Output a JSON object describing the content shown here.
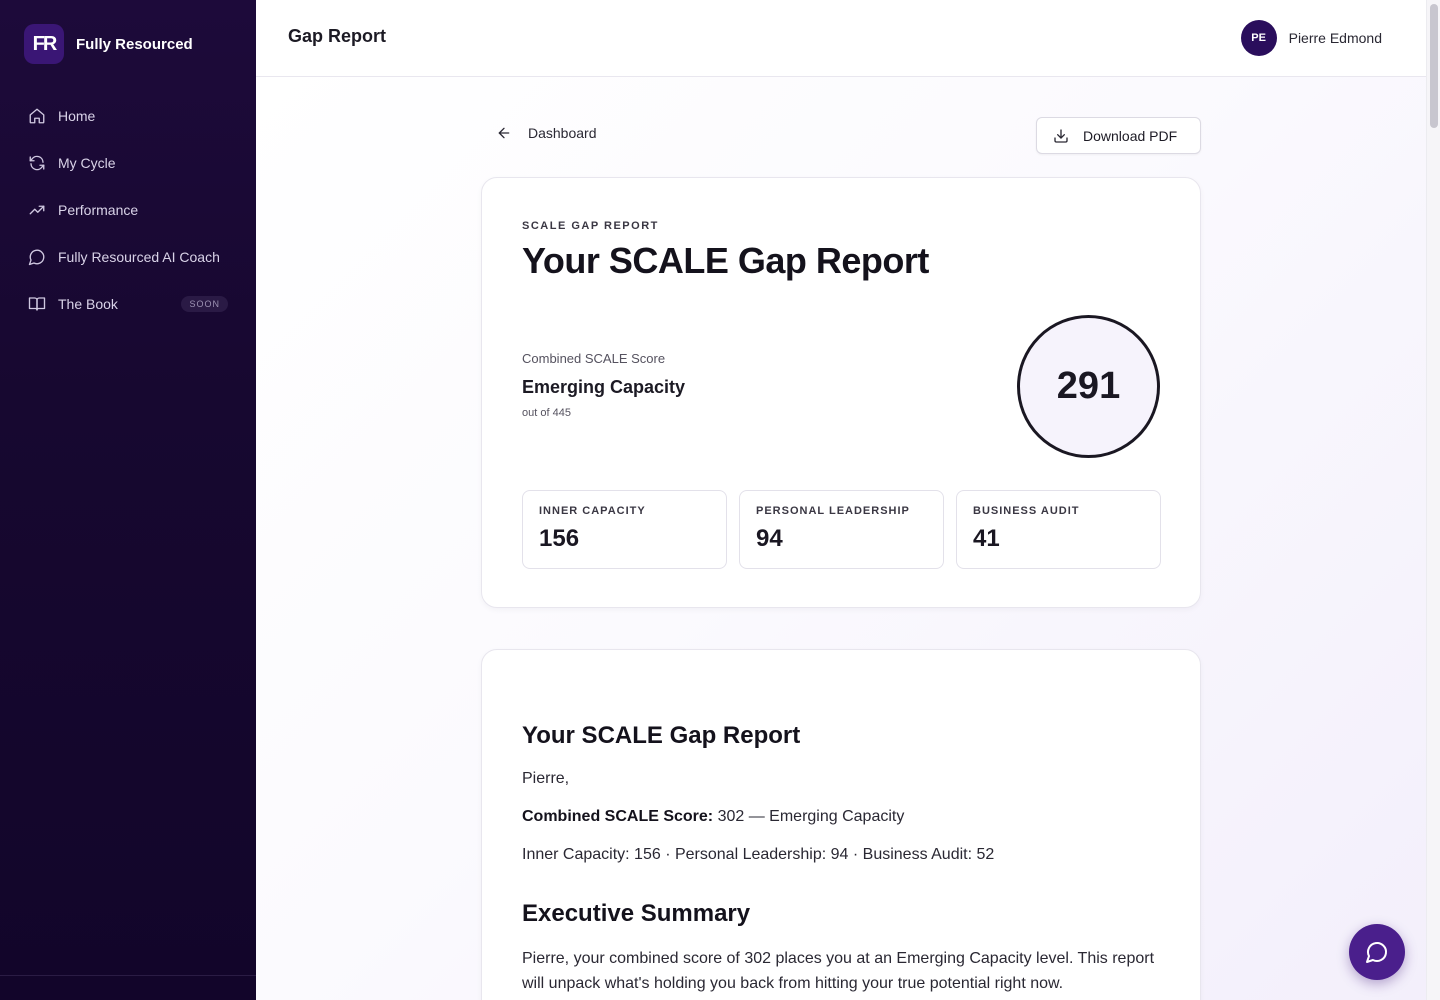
{
  "brand": {
    "logo": "FR",
    "name": "Fully Resourced"
  },
  "sidebar": {
    "items": [
      {
        "label": "Home",
        "icon": "home-icon"
      },
      {
        "label": "My Cycle",
        "icon": "refresh-icon"
      },
      {
        "label": "Performance",
        "icon": "trend-up-icon"
      },
      {
        "label": "Fully Resourced AI Coach",
        "icon": "chat-icon"
      },
      {
        "label": "The Book",
        "icon": "book-icon",
        "badge": "SOON"
      }
    ]
  },
  "header": {
    "title": "Gap Report",
    "user": {
      "initials": "PE",
      "name": "Pierre Edmond"
    }
  },
  "toolbar": {
    "back_label": "Dashboard",
    "download_label": "Download PDF"
  },
  "summary_card": {
    "eyebrow": "SCALE GAP REPORT",
    "title": "Your SCALE Gap Report",
    "combined_label": "Combined SCALE Score",
    "combined_level": "Emerging Capacity",
    "combined_out_of": "out of 445",
    "combined_score": "291",
    "subscores": [
      {
        "label": "INNER CAPACITY",
        "value": "156"
      },
      {
        "label": "PERSONAL LEADERSHIP",
        "value": "94"
      },
      {
        "label": "BUSINESS AUDIT",
        "value": "41"
      }
    ]
  },
  "report": {
    "title": "Your SCALE Gap Report",
    "greeting": "Pierre,",
    "combined_label": "Combined SCALE Score:",
    "combined_text": " 302 — Emerging Capacity",
    "subscores_line": "Inner Capacity: 156 · Personal Leadership: 94 · Business Audit: 52",
    "section_title": "Executive Summary",
    "section_body": "Pierre, your combined score of 302 places you at an Emerging Capacity level. This report will unpack what's holding you back from hitting your true potential right now."
  },
  "colors": {
    "sidebar_bg": "#1d0a3a",
    "accent": "#4a1f8c",
    "avatar": "#2a0e5c"
  }
}
